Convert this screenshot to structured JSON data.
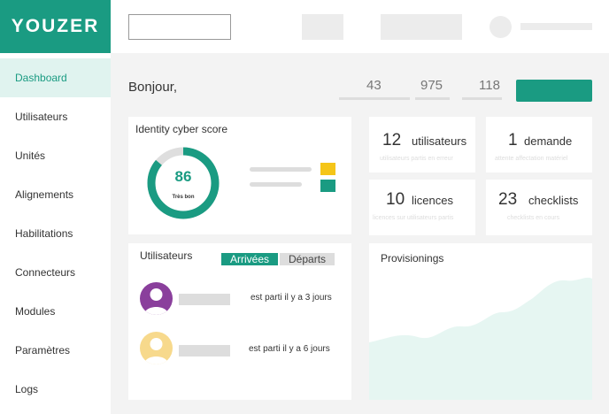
{
  "app": {
    "logo": "YOUZER"
  },
  "sidebar": {
    "items": [
      {
        "label": "Dashboard"
      },
      {
        "label": "Utilisateurs"
      },
      {
        "label": "Unités"
      },
      {
        "label": "Alignements"
      },
      {
        "label": "Habilitations"
      },
      {
        "label": "Connecteurs"
      },
      {
        "label": "Modules"
      },
      {
        "label": "Paramètres"
      },
      {
        "label": "Logs"
      }
    ],
    "active_index": 0
  },
  "header": {
    "greeting": "Bonjour,",
    "stats": [
      "43",
      "975",
      "118"
    ]
  },
  "score": {
    "title": "Identity cyber score",
    "value": "86",
    "rating": "Très bon",
    "fraction": 0.86,
    "colors": {
      "good": "#1a9b82",
      "track": "#dedede",
      "warn": "#f5c518"
    }
  },
  "kpis": [
    {
      "number": "12",
      "label": "utilisateurs",
      "sub": "utilisateurs partis en erreur"
    },
    {
      "number": "1",
      "label": "demande",
      "sub": "attente affectation matériel"
    },
    {
      "number": "10",
      "label": "licences",
      "sub": "licences sur utilisateurs partis"
    },
    {
      "number": "23",
      "label": "checklists",
      "sub": "checklists en cours"
    }
  ],
  "users_card": {
    "title": "Utilisateurs",
    "tab_active": "Arrivées",
    "tab_inactive": "Départs",
    "rows": [
      {
        "status": "est parti il y a 3 jours",
        "avatar_color": "#8a3f9c"
      },
      {
        "status": "est parti il y a 6 jours",
        "avatar_color": "#f7d98c"
      }
    ]
  },
  "provisioning": {
    "title": "Provisionings",
    "area_color": "#e6f6f2"
  }
}
